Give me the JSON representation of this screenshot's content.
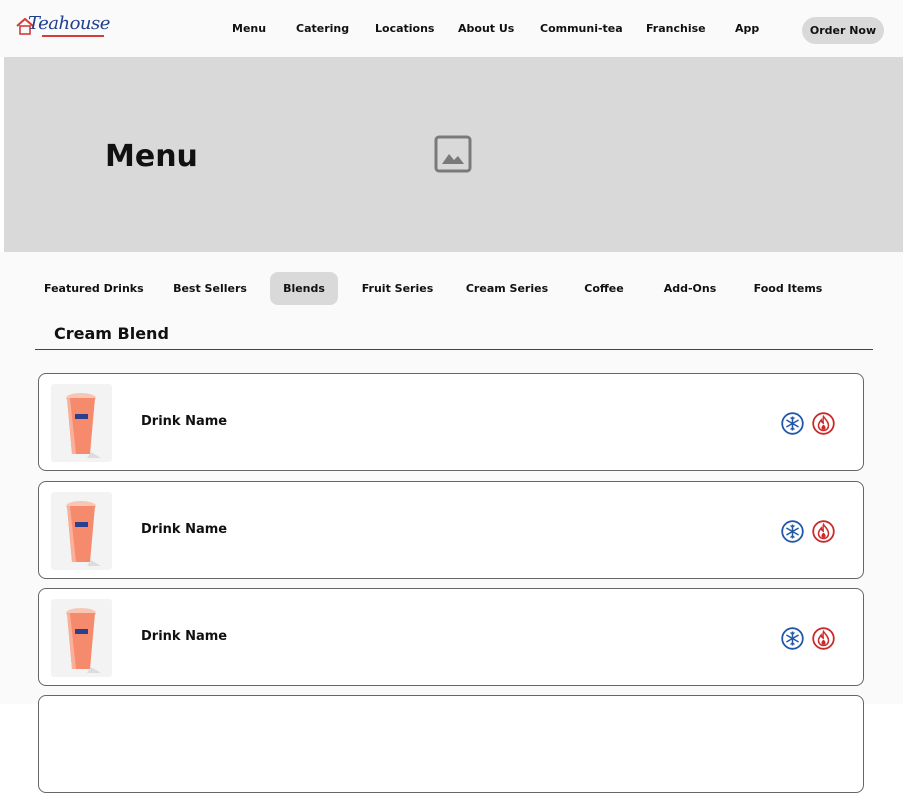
{
  "brand": {
    "logo_text": "Teahouse",
    "primary_color": "#1f3f8f",
    "accent_color": "#d43b3b"
  },
  "nav": {
    "links": [
      "Menu",
      "Catering",
      "Locations",
      "About Us",
      "Communi-tea",
      "Franchise",
      "App"
    ],
    "order_button": "Order Now"
  },
  "hero": {
    "title": "Menu",
    "image_icon": "image-placeholder-icon"
  },
  "tabs": {
    "items": [
      "Featured Drinks",
      "Best Sellers",
      "Blends",
      "Fruit Series",
      "Cream Series",
      "Coffee",
      "Add-Ons",
      "Food Items"
    ],
    "active": "Blends"
  },
  "section": {
    "title": "Cream Blend"
  },
  "drinks": [
    {
      "name": "Drink Name",
      "icons": [
        "snowflake-icon",
        "flame-icon"
      ]
    },
    {
      "name": "Drink Name",
      "icons": [
        "snowflake-icon",
        "flame-icon"
      ]
    },
    {
      "name": "Drink Name",
      "icons": [
        "snowflake-icon",
        "flame-icon"
      ]
    }
  ],
  "colors": {
    "cold": "#2358a8",
    "hot": "#cc2a2a",
    "tab_active_bg": "#d9d9d9",
    "hero_bg": "#d9d9d9"
  }
}
